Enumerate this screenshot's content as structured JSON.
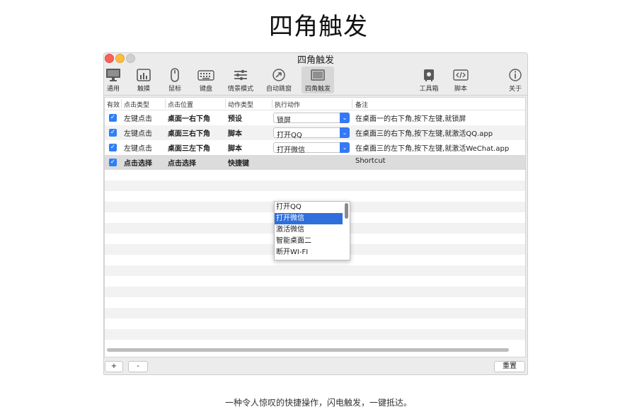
{
  "page": {
    "title": "四角触发",
    "caption": "一种令人惊叹的快捷操作，闪电触发，一键抵达。"
  },
  "window": {
    "title": "四角触发",
    "toolbar": [
      {
        "label": "通用",
        "icon": "monitor-icon"
      },
      {
        "label": "触摸",
        "icon": "trackpad-icon"
      },
      {
        "label": "鼠标",
        "icon": "mouse-icon"
      },
      {
        "label": "键盘",
        "icon": "keyboard-icon"
      },
      {
        "label": "情景模式",
        "icon": "sliders-icon"
      },
      {
        "label": "自动跳窗",
        "icon": "arrow-circle-icon"
      },
      {
        "label": "四角触发",
        "icon": "corners-icon",
        "selected": true
      },
      {
        "label": "工具箱",
        "icon": "toolbox-icon"
      },
      {
        "label": "脚本",
        "icon": "code-icon"
      },
      {
        "label": "关于",
        "icon": "info-icon"
      }
    ]
  },
  "table": {
    "columns": [
      "有效",
      "点击类型",
      "点击位置",
      "动作类型",
      "执行动作",
      "备注"
    ],
    "rows": [
      {
        "enabled": true,
        "click_type": "左键点击",
        "position": "桌面一右下角",
        "action_type": "预设",
        "action": "锁屏",
        "note": "在桌面一的右下角,按下左键,就锁屏"
      },
      {
        "enabled": true,
        "click_type": "左键点击",
        "position": "桌面三右下角",
        "action_type": "脚本",
        "action": "打开QQ",
        "note": "在桌面三的右下角,按下左键,就激活QQ.app"
      },
      {
        "enabled": true,
        "click_type": "左键点击",
        "position": "桌面三左下角",
        "action_type": "脚本",
        "action": "打开微信",
        "note": "在桌面三的左下角,按下左键,就激活WeChat.app"
      },
      {
        "enabled": true,
        "click_type": "点击选择",
        "position": "点击选择",
        "action_type": "快捷键",
        "action": "",
        "note": "Shortcut"
      }
    ]
  },
  "dropdown": {
    "options": [
      "打开QQ",
      "打开微信",
      "激活微信",
      "智能桌面二",
      "断开WI-FI"
    ],
    "highlighted": "打开微信"
  },
  "bottom": {
    "add_label": "+",
    "remove_label": "-",
    "reset_label": "重置"
  },
  "colors": {
    "accent": "#3478f6",
    "highlight": "#2f6fdc",
    "close": "#fc605b",
    "minimize": "#fdbc40"
  }
}
